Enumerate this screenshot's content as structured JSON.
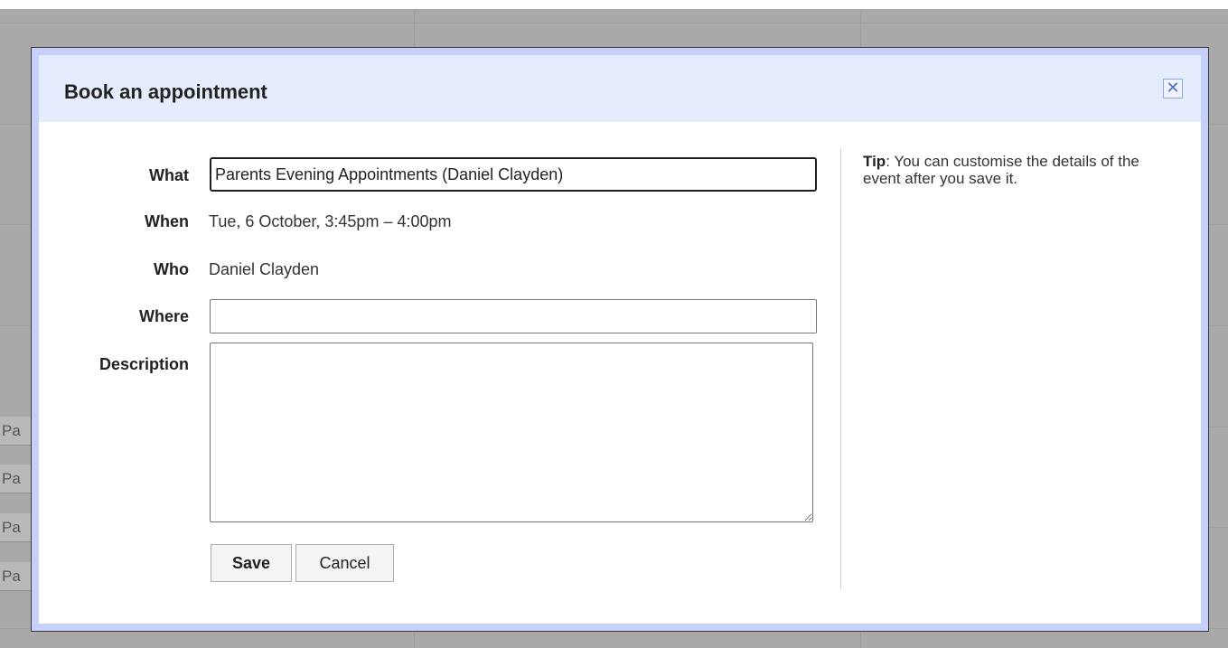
{
  "background": {
    "event_snippets": [
      "Pa",
      "Pa",
      "Pa",
      "Pa"
    ]
  },
  "dialog": {
    "title": "Book an appointment",
    "close_glyph": "✕",
    "fields": {
      "what": {
        "label": "What",
        "value": "Parents Evening Appointments (Daniel Clayden)"
      },
      "when": {
        "label": "When",
        "value": "Tue, 6 October, 3:45pm – 4:00pm"
      },
      "who": {
        "label": "Who",
        "value": "Daniel Clayden"
      },
      "where": {
        "label": "Where",
        "value": ""
      },
      "description": {
        "label": "Description",
        "value": ""
      }
    },
    "buttons": {
      "save": "Save",
      "cancel": "Cancel"
    },
    "tip": {
      "label": "Tip",
      "text": ": You can customise the details of the event after you save it."
    }
  },
  "colors": {
    "header_bg": "#e5ecfd",
    "frame": "#c6d0fa",
    "overlay": "#a9a9a9"
  }
}
